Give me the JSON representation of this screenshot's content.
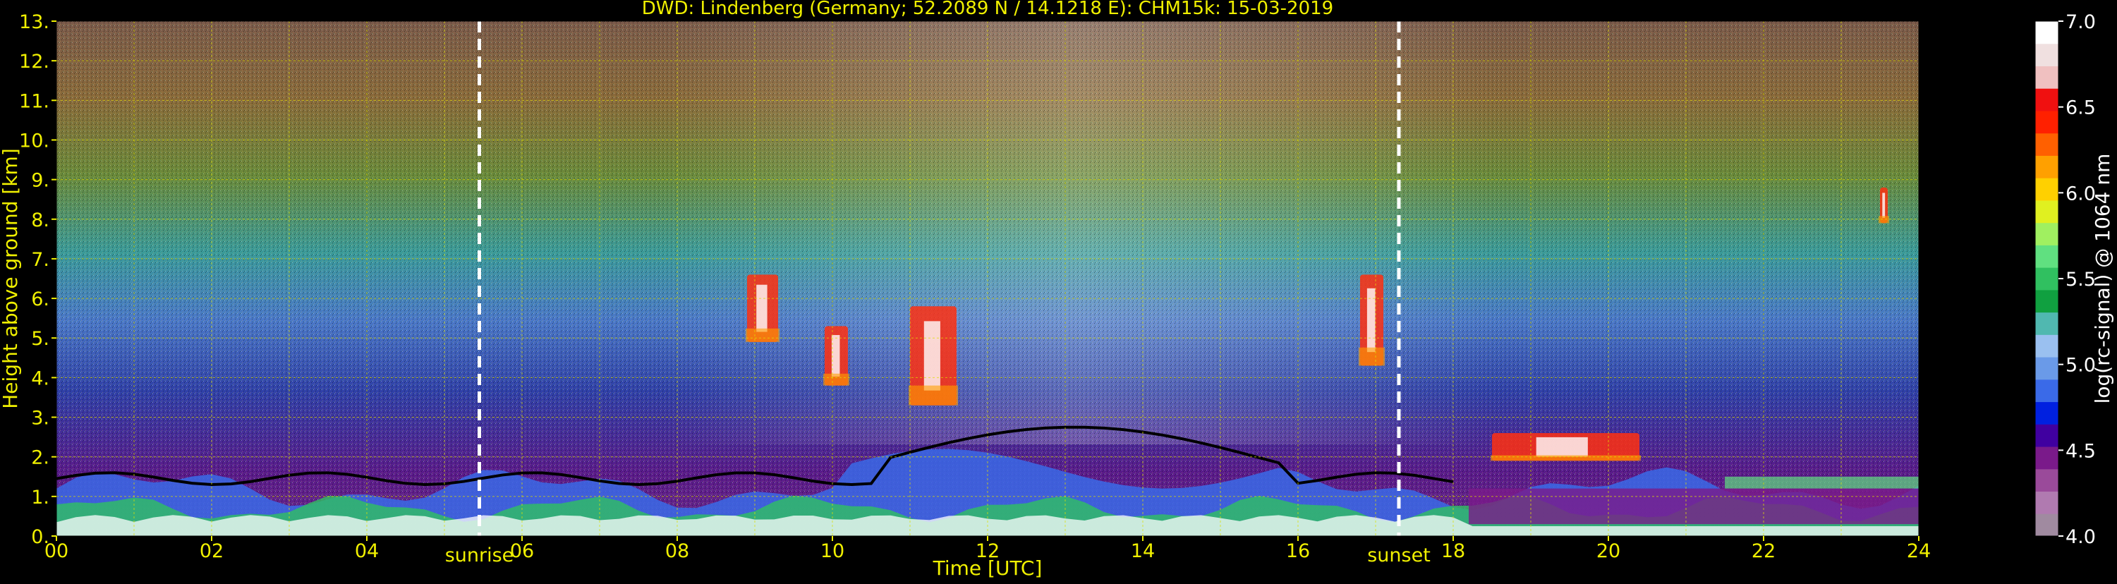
{
  "chart_data": {
    "type": "heatmap",
    "title": "DWD: Lindenberg (Germany; 52.2089 N / 14.1218 E):    CHM15k: 15-03-2019",
    "xlabel": "Time [UTC]",
    "ylabel": "Height above ground [km]",
    "xlim": [
      0,
      24
    ],
    "ylim": [
      0,
      13
    ],
    "x_ticks": [
      "00",
      "02",
      "04",
      "06",
      "08",
      "10",
      "12",
      "14",
      "16",
      "18",
      "20",
      "22",
      "24"
    ],
    "y_ticks": [
      "0.",
      "1.",
      "2.",
      "3.",
      "4.",
      "5.",
      "6.",
      "7.",
      "8.",
      "9.",
      "10.",
      "11.",
      "12.",
      "13."
    ],
    "grid": true,
    "markers": [
      {
        "label": "sunrise",
        "time": 5.45
      },
      {
        "label": "sunset",
        "time": 17.3
      }
    ],
    "colorbar": {
      "label": "log(rc-signal) @ 1064 nm",
      "range": [
        4.0,
        7.0
      ],
      "ticks": [
        "4.0",
        "4.5",
        "5.0",
        "5.5",
        "6.0",
        "6.5",
        "7.0"
      ],
      "colors": [
        "#a08aa0",
        "#b07ab0",
        "#9a4a9a",
        "#7a1a8a",
        "#4000a0",
        "#0020e0",
        "#3a6ae8",
        "#6a9ae8",
        "#9ac0f0",
        "#50b8b0",
        "#10a040",
        "#30c060",
        "#60e080",
        "#a0f060",
        "#e0f020",
        "#ffd000",
        "#ffa000",
        "#ff6000",
        "#ff2000",
        "#f01010",
        "#f0c0c0",
        "#f0e0e0",
        "#ffffff"
      ]
    },
    "features": [
      {
        "kind": "boundary_layer_top",
        "description_time": [
          0,
          24
        ],
        "height_km": [
          0.5,
          2.9
        ]
      },
      {
        "kind": "cloud",
        "time": [
          8.9,
          9.3
        ],
        "height_km": [
          4.9,
          6.6
        ]
      },
      {
        "kind": "cloud",
        "time": [
          9.9,
          10.2
        ],
        "height_km": [
          3.8,
          5.3
        ]
      },
      {
        "kind": "cloud",
        "time": [
          11.0,
          11.6
        ],
        "height_km": [
          3.3,
          5.8
        ]
      },
      {
        "kind": "cloud",
        "time": [
          16.8,
          17.1
        ],
        "height_km": [
          4.3,
          6.6
        ]
      },
      {
        "kind": "cloud",
        "time": [
          18.5,
          20.4
        ],
        "height_km": [
          1.9,
          2.6
        ]
      },
      {
        "kind": "cloud",
        "time": [
          23.5,
          23.6
        ],
        "height_km": [
          7.9,
          8.8
        ]
      }
    ]
  }
}
